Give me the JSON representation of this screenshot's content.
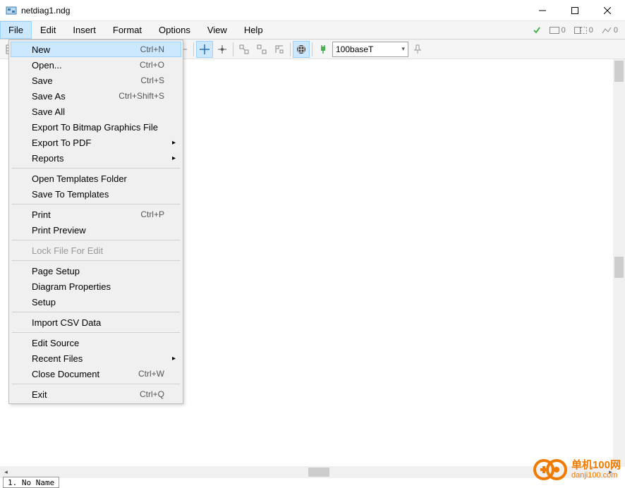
{
  "window": {
    "title": "netdiag1.ndg"
  },
  "menubar": {
    "items": [
      "File",
      "Edit",
      "Insert",
      "Format",
      "Options",
      "View",
      "Help"
    ],
    "status": [
      {
        "icon": "check",
        "value": ""
      },
      {
        "icon": "rect",
        "value": "0"
      },
      {
        "icon": "rect-dash",
        "value": "0"
      },
      {
        "icon": "zigzag",
        "value": "0"
      }
    ]
  },
  "dropdown": {
    "groups": [
      [
        {
          "label": "New",
          "shortcut": "Ctrl+N",
          "highlight": true
        },
        {
          "label": "Open...",
          "shortcut": "Ctrl+O"
        },
        {
          "label": "Save",
          "shortcut": "Ctrl+S"
        },
        {
          "label": "Save As",
          "shortcut": "Ctrl+Shift+S"
        },
        {
          "label": "Save All"
        },
        {
          "label": "Export To Bitmap Graphics File"
        },
        {
          "label": "Export To PDF",
          "submenu": true
        },
        {
          "label": "Reports",
          "submenu": true
        }
      ],
      [
        {
          "label": "Open Templates Folder"
        },
        {
          "label": "Save To Templates"
        }
      ],
      [
        {
          "label": "Print",
          "shortcut": "Ctrl+P"
        },
        {
          "label": "Print Preview"
        }
      ],
      [
        {
          "label": "Lock File For Edit",
          "disabled": true
        }
      ],
      [
        {
          "label": "Page Setup"
        },
        {
          "label": "Diagram Properties"
        },
        {
          "label": "Setup"
        }
      ],
      [
        {
          "label": "Import CSV Data"
        }
      ],
      [
        {
          "label": "Edit Source"
        },
        {
          "label": "Recent Files",
          "submenu": true
        },
        {
          "label": "Close Document",
          "shortcut": "Ctrl+W"
        }
      ],
      [
        {
          "label": "Exit",
          "shortcut": "Ctrl+Q"
        }
      ]
    ]
  },
  "toolbar": {
    "combo_value": "100baseT"
  },
  "tabs": {
    "tab1": "1. No Name"
  },
  "watermark": {
    "cn": "单机100网",
    "url": "danji100.com"
  }
}
